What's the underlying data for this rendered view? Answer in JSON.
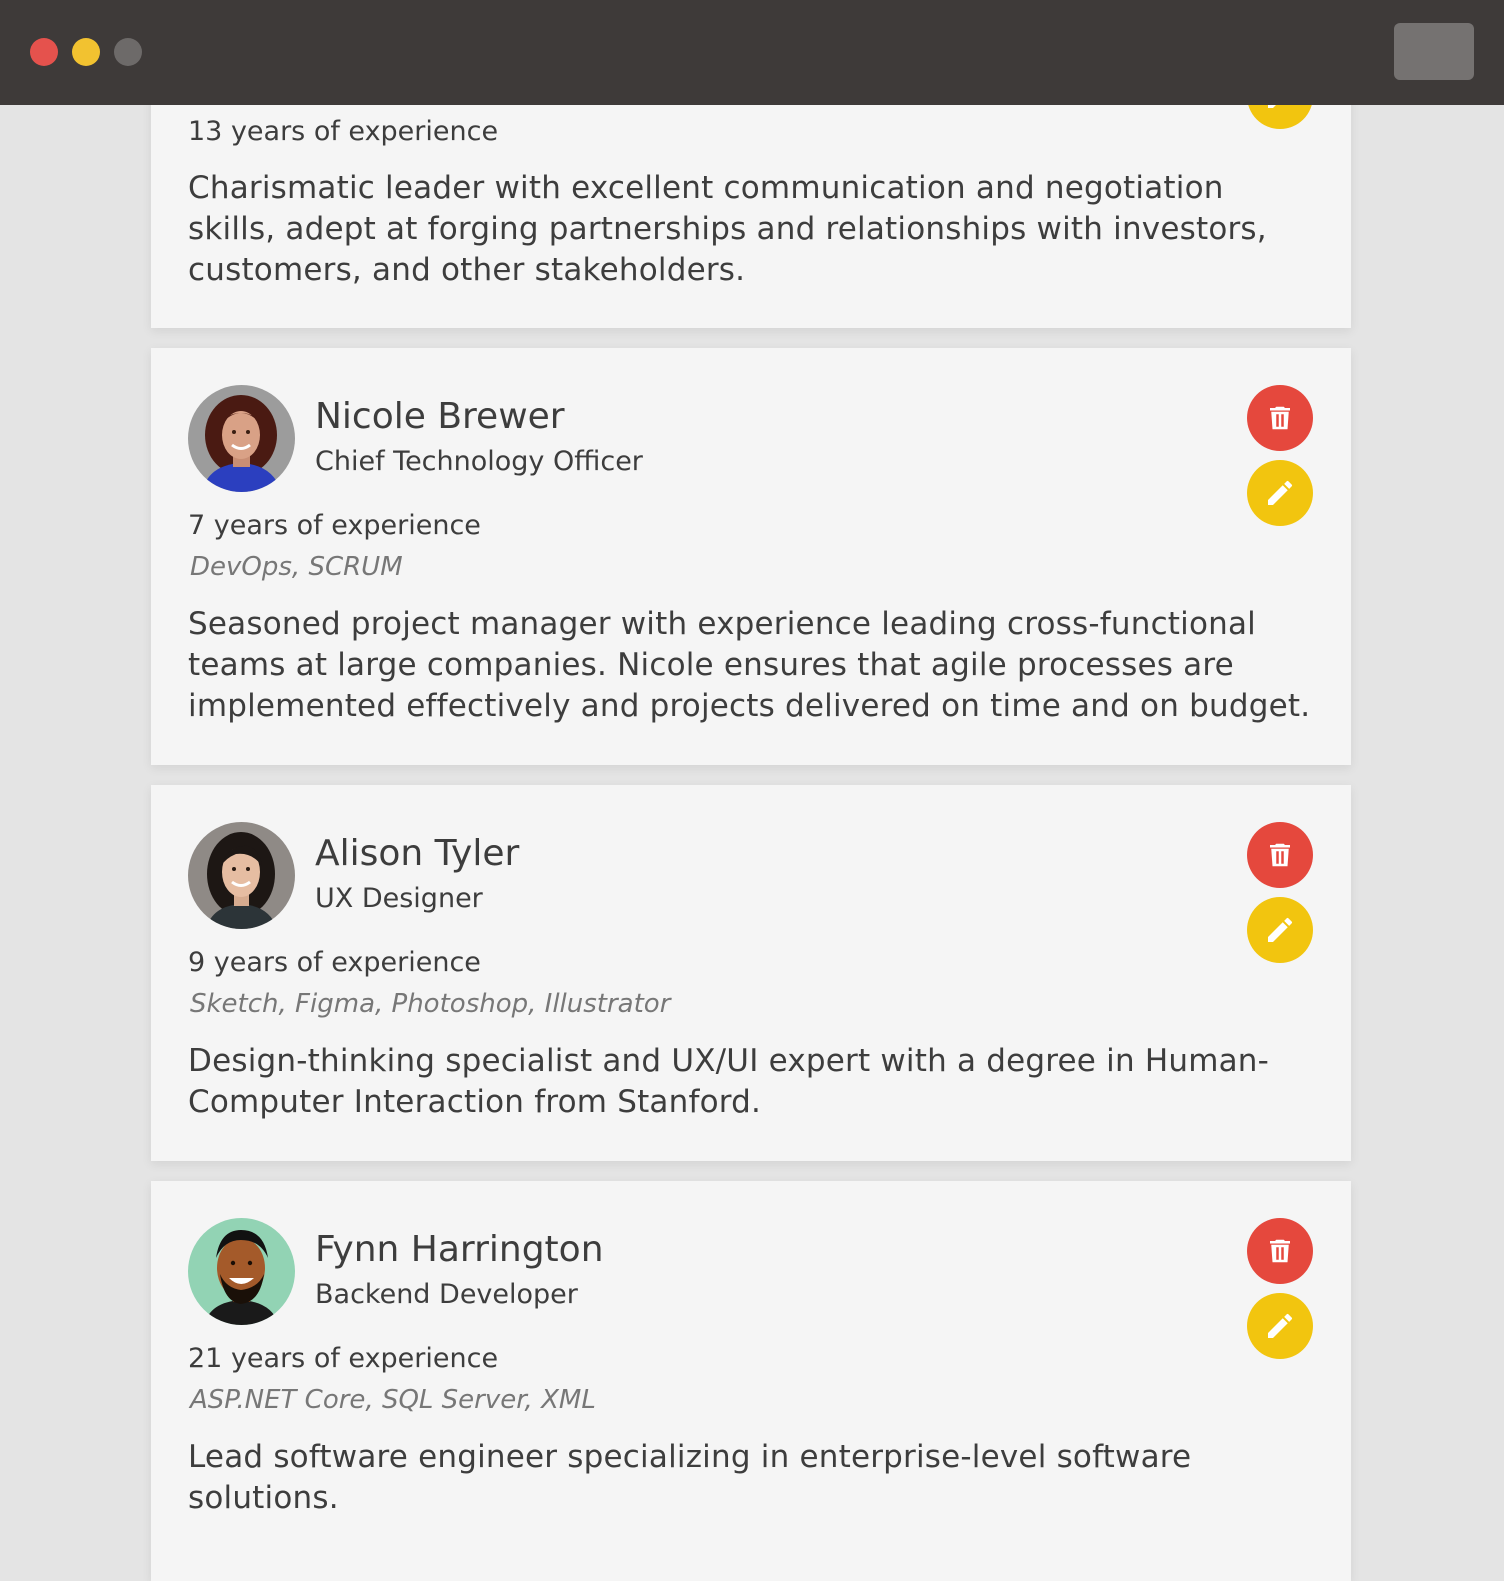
{
  "window": {
    "controls": [
      "close",
      "minimize",
      "maximize"
    ],
    "menu_button": "menu-button"
  },
  "colors": {
    "titlebar": "#3e3a39",
    "card": "#f5f5f5",
    "delete": "#e5483d",
    "edit": "#f2c50f"
  },
  "icons": {
    "delete": "trash-icon",
    "edit": "pencil-icon"
  },
  "people": [
    {
      "name": "",
      "title": "",
      "experience": "13 years of experience",
      "skills": "",
      "bio": "Charismatic leader with excellent communication and negotiation skills, adept at forging partnerships and relationships with investors, customers, and other stakeholders."
    },
    {
      "name": "Nicole Brewer",
      "title": "Chief Technology Officer",
      "experience": "7 years of experience",
      "skills": "DevOps, SCRUM",
      "bio": "Seasoned project manager with experience leading cross-functional teams at large companies. Nicole ensures that agile processes are implemented effectively and projects delivered on time and on budget."
    },
    {
      "name": "Alison Tyler",
      "title": "UX Designer",
      "experience": "9 years of experience",
      "skills": "Sketch, Figma, Photoshop, Illustrator",
      "bio": "Design-thinking specialist and UX/UI expert with a degree in Human-Computer Interaction from Stanford."
    },
    {
      "name": "Fynn Harrington",
      "title": "Backend Developer",
      "experience": "21 years of experience",
      "skills": "ASP.NET Core, SQL Server, XML",
      "bio": "Lead software engineer specializing in enterprise-level software solutions."
    }
  ]
}
